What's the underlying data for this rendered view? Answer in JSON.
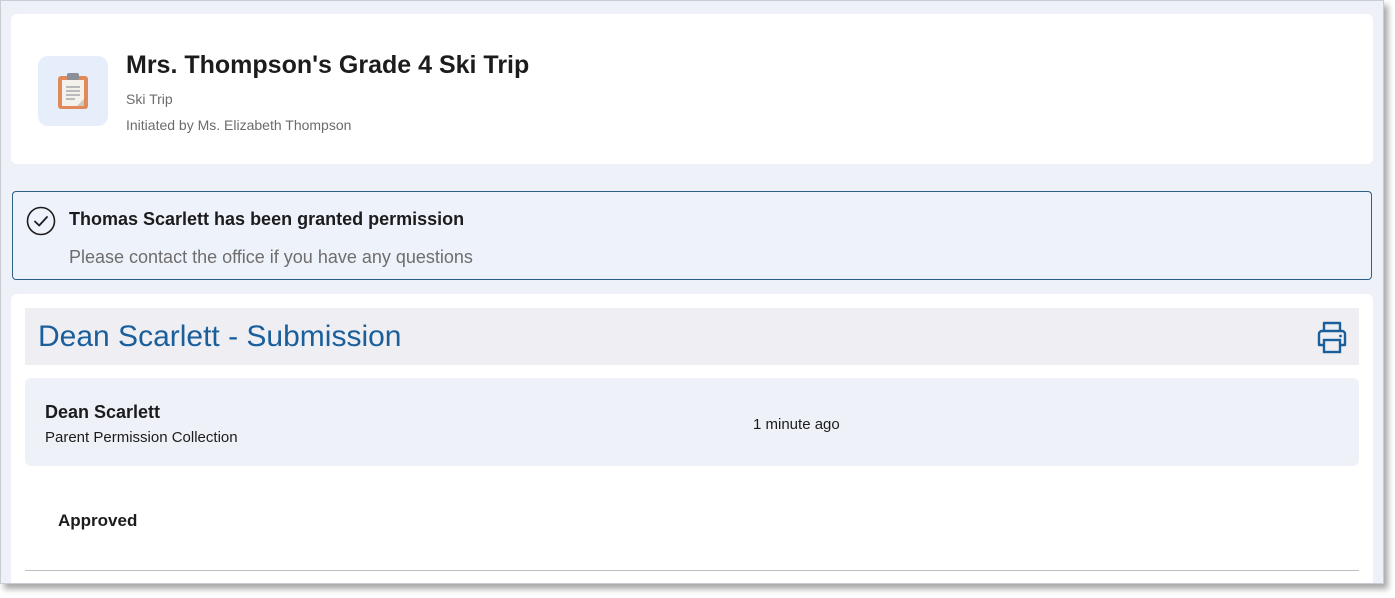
{
  "header": {
    "icon": "clipboard-icon",
    "title": "Mrs. Thompson's Grade 4 Ski Trip",
    "subtitle": "Ski Trip",
    "initiated_by": "Initiated by Ms. Elizabeth Thompson"
  },
  "notice": {
    "icon": "check-circle-icon",
    "title": "Thomas Scarlett has been granted permission",
    "message": "Please contact the office if you have any questions"
  },
  "submission": {
    "title": "Dean Scarlett - Submission",
    "print_icon": "printer-icon",
    "entry": {
      "name": "Dean Scarlett",
      "collection": "Parent Permission Collection",
      "time": "1 minute ago"
    },
    "status": "Approved"
  },
  "colors": {
    "accent": "#1a5f9b",
    "notice_border": "#2b5f86",
    "page_background": "#eef1f7"
  }
}
